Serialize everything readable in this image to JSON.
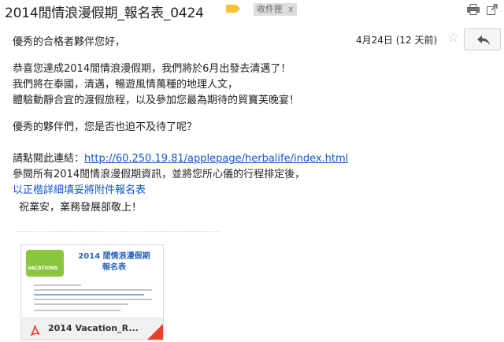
{
  "email": {
    "subject": "2014閒情浪漫假期_報名表_0424",
    "label_chip": "收件匣",
    "label_chip_close": "x",
    "sender": "優秀的合格者夥伴您好，",
    "date": "4月24日 (12 天前)"
  },
  "body": {
    "p1_l1": "恭喜您達成2014閒情浪漫假期，我們將於6月出發去清邁了！",
    "p1_l2": "我們將在泰國，清邁，暢遊風情萬種的地理人文，",
    "p1_l3": "體驗動靜合宜的渡假旅程，以及參加您最為期待的貿寶芙晚宴！",
    "p2": "優秀的夥伴們，您是否也迫不及待了呢？",
    "p3_prefix": "請點閱此連結：",
    "p3_link": "http://60.250.19.81/applepage/herbalife/index.html",
    "p3_l2": "參閱所有2014閒情浪漫假期資訊，並將您所心儀的行程排定後，",
    "p3_l3": "以正楷詳細填妥將附件報名表",
    "p4": "祝業安，業務發展部敬上！"
  },
  "attachment": {
    "file_name": "2014 Vacation_R...",
    "thumb_title_l1": "2014 閒情浪漫假期",
    "thumb_title_l2": "報名表",
    "thumb_logo_text": "VACATIONS"
  },
  "colors": {
    "link": "#1155cc",
    "label_tag": "#f4c430",
    "pdf_red": "#e8412c"
  },
  "icons": [
    "label-tag-icon",
    "print-icon",
    "new-window-icon",
    "star-icon",
    "reply-icon",
    "pdf-icon"
  ]
}
